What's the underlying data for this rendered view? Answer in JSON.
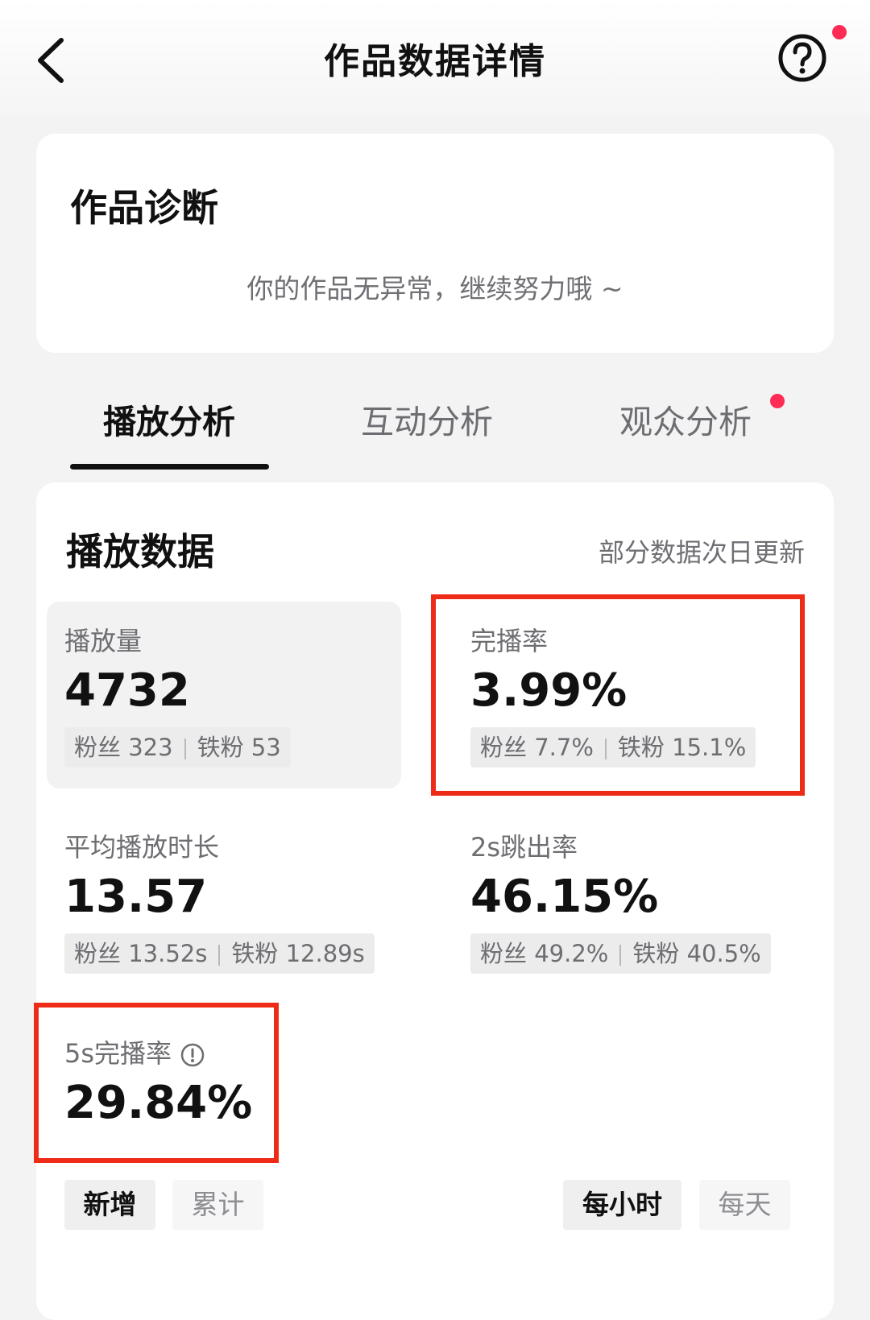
{
  "header": {
    "title": "作品数据详情"
  },
  "diagnosis": {
    "title": "作品诊断",
    "message": "你的作品无异常，继续努力哦 ~"
  },
  "tabs": [
    {
      "label": "播放分析",
      "active": true
    },
    {
      "label": "互动分析",
      "active": false
    },
    {
      "label": "观众分析",
      "active": false,
      "badge": true
    }
  ],
  "play_data": {
    "title": "播放数据",
    "note": "部分数据次日更新",
    "metrics": {
      "views": {
        "label": "播放量",
        "value": "4732",
        "fans": "粉丝 323",
        "iron_fans": "铁粉 53"
      },
      "completion": {
        "label": "完播率",
        "value": "3.99%",
        "fans": "粉丝 7.7%",
        "iron_fans": "铁粉 15.1%",
        "highlighted": true
      },
      "avg_duration": {
        "label": "平均播放时长",
        "value": "13.57",
        "fans": "粉丝 13.52s",
        "iron_fans": "铁粉 12.89s"
      },
      "bounce_2s": {
        "label": "2s跳出率",
        "value": "46.15%",
        "fans": "粉丝 49.2%",
        "iron_fans": "铁粉 40.5%"
      },
      "completion_5s": {
        "label": "5s完播率",
        "value": "29.84%",
        "highlighted": true,
        "has_info_icon": true
      }
    }
  },
  "toggles": {
    "mode": [
      {
        "label": "新增",
        "selected": true
      },
      {
        "label": "累计",
        "selected": false
      }
    ],
    "granularity": [
      {
        "label": "每小时",
        "selected": true
      },
      {
        "label": "每天",
        "selected": false
      }
    ]
  },
  "colors": {
    "accent_red": "#fe2c55",
    "highlight_box": "#ee2b16",
    "background": "#f3f3f4"
  },
  "icons": {
    "back": "chevron-left-icon",
    "help": "question-circle-icon",
    "info": "info-circle-icon"
  }
}
